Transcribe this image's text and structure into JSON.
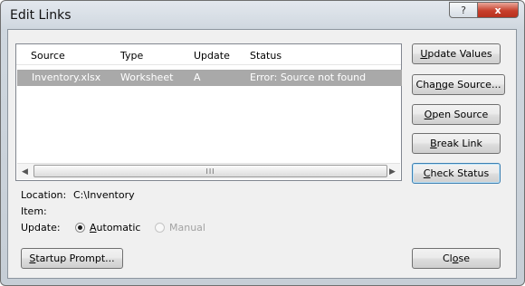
{
  "window": {
    "title": "Edit Links",
    "help_glyph": "?",
    "close_glyph": "x"
  },
  "links_table": {
    "columns": [
      "Source",
      "Type",
      "Update",
      "Status"
    ],
    "rows": [
      {
        "source": "Inventory.xlsx",
        "type": "Worksheet",
        "update": "A",
        "status": "Error: Source not found"
      }
    ],
    "scroll_left_glyph": "◀",
    "scroll_right_glyph": "▶",
    "thumb_grip": "III"
  },
  "buttons": {
    "update_values": {
      "pre": "",
      "accel": "U",
      "post": "pdate Values"
    },
    "change_source": {
      "pre": "Cha",
      "accel": "n",
      "post": "ge Source..."
    },
    "open_source": {
      "pre": "",
      "accel": "O",
      "post": "pen Source"
    },
    "break_link": {
      "pre": "",
      "accel": "B",
      "post": "reak Link"
    },
    "check_status": {
      "pre": "",
      "accel": "C",
      "post": "heck Status"
    },
    "startup_prompt": {
      "pre": "",
      "accel": "S",
      "post": "tartup Prompt..."
    },
    "close": {
      "pre": "Cl",
      "accel": "o",
      "post": "se"
    }
  },
  "details": {
    "location_label": "Location:",
    "location_value": "C:\\Inventory",
    "item_label": "Item:",
    "item_value": "",
    "update_label": "Update:"
  },
  "update_mode": {
    "automatic": {
      "pre": "",
      "accel": "A",
      "post": "utomatic",
      "selected": true
    },
    "manual": {
      "label": "Manual",
      "selected": false,
      "enabled": false
    }
  }
}
